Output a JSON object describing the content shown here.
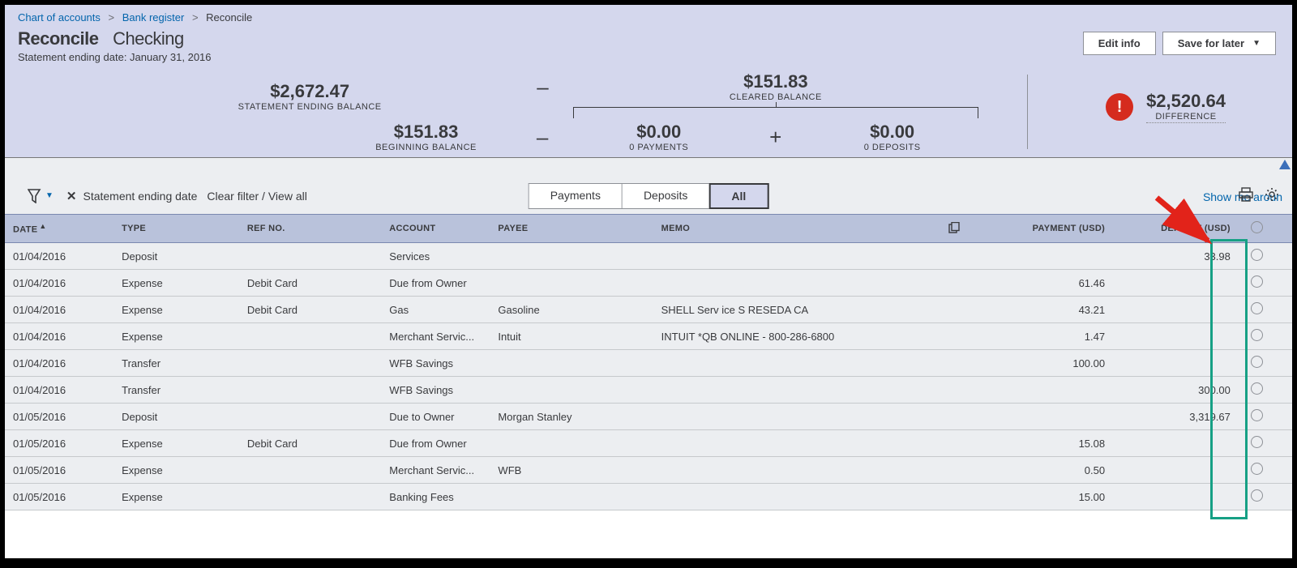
{
  "breadcrumb": {
    "items": [
      "Chart of accounts",
      "Bank register",
      "Reconcile"
    ]
  },
  "page": {
    "title": "Reconcile",
    "account": "Checking",
    "statement_date_label": "Statement ending date: January 31, 2016"
  },
  "actions": {
    "edit": "Edit info",
    "save": "Save for later"
  },
  "balances": {
    "stmt_ending": {
      "amount": "$2,672.47",
      "label": "STATEMENT ENDING BALANCE"
    },
    "cleared": {
      "amount": "$151.83",
      "label": "CLEARED BALANCE"
    },
    "beginning": {
      "amount": "$151.83",
      "label": "BEGINNING BALANCE"
    },
    "payments": {
      "amount": "$0.00",
      "label": "0 PAYMENTS"
    },
    "deposits": {
      "amount": "$0.00",
      "label": "0 DEPOSITS"
    },
    "minus": "–",
    "plus": "+"
  },
  "difference": {
    "amount": "$2,520.64",
    "label": "DIFFERENCE"
  },
  "filters": {
    "chip": "Statement ending date",
    "clear": "Clear filter / View all"
  },
  "segments": {
    "payments": "Payments",
    "deposits": "Deposits",
    "all": "All"
  },
  "show_around": "Show me aroun",
  "columns": {
    "date": "DATE",
    "type": "TYPE",
    "ref": "REF NO.",
    "account": "ACCOUNT",
    "payee": "PAYEE",
    "memo": "MEMO",
    "payment": "PAYMENT (USD)",
    "deposit": "DEPOSIT (USD)"
  },
  "rows": [
    {
      "date": "01/04/2016",
      "type": "Deposit",
      "ref": "",
      "account": "Services",
      "payee": "",
      "memo": "",
      "payment": "",
      "deposit": "33.98"
    },
    {
      "date": "01/04/2016",
      "type": "Expense",
      "ref": "Debit Card",
      "account": "Due from Owner",
      "payee": "",
      "memo": "",
      "payment": "61.46",
      "deposit": ""
    },
    {
      "date": "01/04/2016",
      "type": "Expense",
      "ref": "Debit Card",
      "account": "Gas",
      "payee": "Gasoline",
      "memo": "SHELL Serv ice S RESEDA CA",
      "payment": "43.21",
      "deposit": ""
    },
    {
      "date": "01/04/2016",
      "type": "Expense",
      "ref": "",
      "account": "Merchant Servic...",
      "payee": "Intuit",
      "memo": "INTUIT *QB ONLINE - 800-286-6800",
      "payment": "1.47",
      "deposit": ""
    },
    {
      "date": "01/04/2016",
      "type": "Transfer",
      "ref": "",
      "account": "WFB Savings",
      "payee": "",
      "memo": "",
      "payment": "100.00",
      "deposit": ""
    },
    {
      "date": "01/04/2016",
      "type": "Transfer",
      "ref": "",
      "account": "WFB Savings",
      "payee": "",
      "memo": "",
      "payment": "",
      "deposit": "300.00"
    },
    {
      "date": "01/05/2016",
      "type": "Deposit",
      "ref": "",
      "account": "Due to Owner",
      "payee": "Morgan Stanley",
      "memo": "",
      "payment": "",
      "deposit": "3,319.67"
    },
    {
      "date": "01/05/2016",
      "type": "Expense",
      "ref": "Debit Card",
      "account": "Due from Owner",
      "payee": "",
      "memo": "",
      "payment": "15.08",
      "deposit": ""
    },
    {
      "date": "01/05/2016",
      "type": "Expense",
      "ref": "",
      "account": "Merchant Servic...",
      "payee": "WFB",
      "memo": "",
      "payment": "0.50",
      "deposit": ""
    },
    {
      "date": "01/05/2016",
      "type": "Expense",
      "ref": "",
      "account": "Banking Fees",
      "payee": "",
      "memo": "",
      "payment": "15.00",
      "deposit": ""
    }
  ]
}
